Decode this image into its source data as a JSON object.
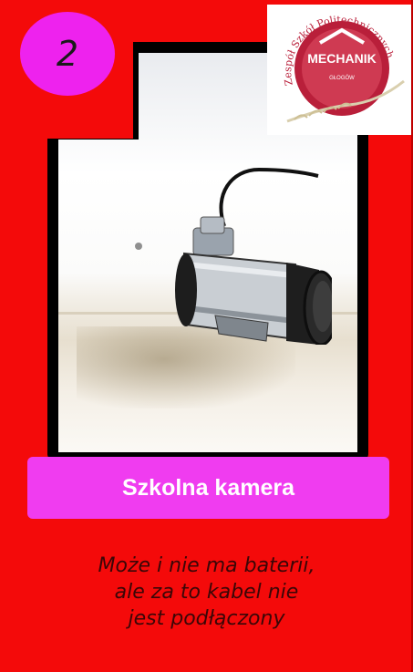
{
  "card": {
    "number": "2",
    "title": "Szkolna kamera",
    "description_lines": [
      "Może i nie ma baterii,",
      "ale za to kabel nie",
      "jest podłączony"
    ],
    "image_subject": "security-camera-icon"
  },
  "logo": {
    "arc_text": "Zespół Szkół Politechnicznych",
    "name": "MECHANIK",
    "city": "GŁOGÓW"
  },
  "colors": {
    "card_background": "#f40a0a",
    "badge": "#ee22ee",
    "title_bar": "#f03cf0",
    "title_text": "#ffffff",
    "logo_red": "#b91f3a"
  }
}
